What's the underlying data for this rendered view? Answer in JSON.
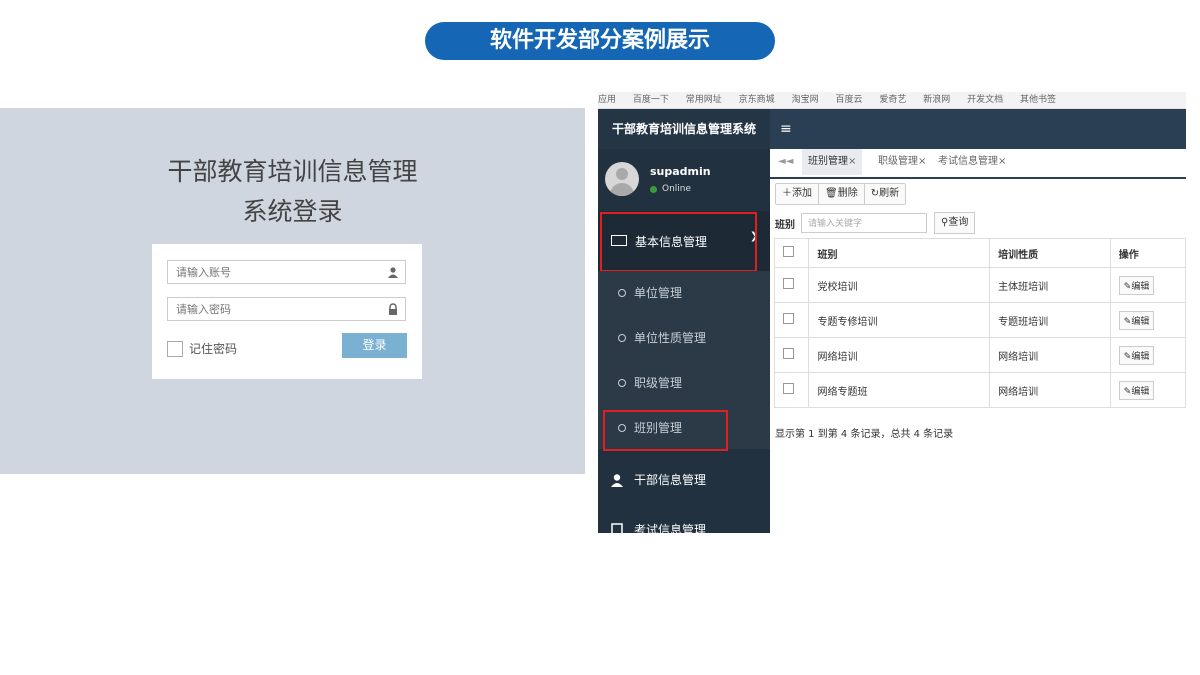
{
  "banner": {
    "title": "软件开发部分案例展示"
  },
  "login": {
    "title_line1": "干部教育培训信息管理",
    "title_line2": "系统登录",
    "account_placeholder": "请输入账号",
    "password_placeholder": "请输入密码",
    "remember_label": "记住密码",
    "login_button": "登录"
  },
  "browser": {
    "bookmarks": [
      "应用",
      "百度一下",
      "常用网址",
      "京东商城",
      "淘宝网",
      "百度云",
      "爱奇艺",
      "新浪网",
      "开发文档",
      "其他书签"
    ]
  },
  "app": {
    "brand": "干部教育培训信息管理系统",
    "menu_icon": "≡",
    "user": {
      "name": "supadmin",
      "status": "Online"
    },
    "sidebar": {
      "group_label": "基本信息管理",
      "group_chevron": "❯",
      "sub_items": [
        "单位管理",
        "单位性质管理",
        "职级管理",
        "班别管理"
      ],
      "main_items": [
        "干部信息管理",
        "考试信息管理"
      ]
    },
    "tabs": [
      {
        "label": "班别管理",
        "close": "×"
      },
      {
        "label": "职级管理",
        "close": "×"
      },
      {
        "label": "考试信息管理",
        "close": "×"
      }
    ],
    "tab_nav_arrow": "◄◄",
    "toolbar": {
      "add": "添加",
      "delete": "删除",
      "refresh": "刷新"
    },
    "search": {
      "label": "班别",
      "placeholder": "请输入关键字",
      "button": "查询"
    },
    "table": {
      "headers": [
        "",
        "班别",
        "培训性质",
        "操作"
      ],
      "rows": [
        {
          "class": "党校培训",
          "nature": "主体班培训",
          "action": "编辑"
        },
        {
          "class": "专题专修培训",
          "nature": "专题班培训",
          "action": "编辑"
        },
        {
          "class": "网络培训",
          "nature": "网络培训",
          "action": "编辑"
        },
        {
          "class": "网络专题班",
          "nature": "网络培训",
          "action": "编辑"
        }
      ]
    },
    "summary": "显示第 1 到第 4 条记录，总共 4 条记录"
  },
  "colors": {
    "banner": "#1566b5",
    "topbar": "#2a3f54",
    "sidebar": "#22313f",
    "highlight": "#e02020"
  }
}
